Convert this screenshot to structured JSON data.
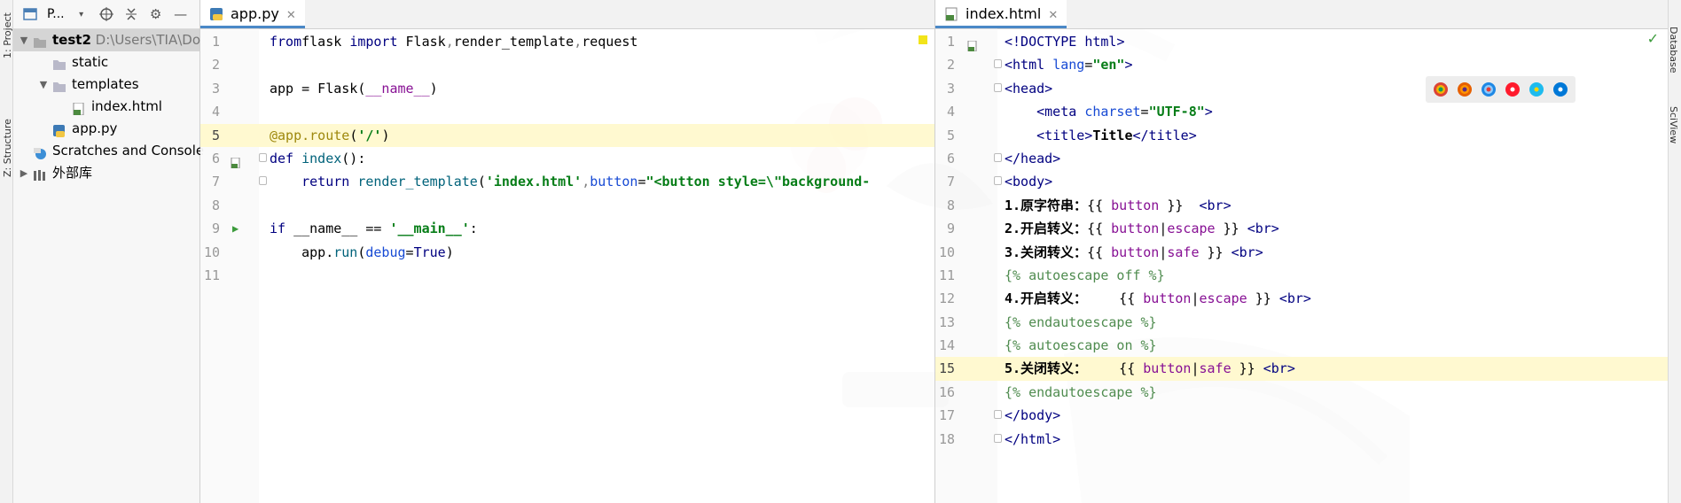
{
  "tool_windows": {
    "left": [
      "1: Project",
      "Z: Structure"
    ],
    "right": [
      "Database",
      "SciView"
    ]
  },
  "project_panel": {
    "toolbar_label": "P...",
    "tree": [
      {
        "label": "test2",
        "detail": "D:\\Users\\TIA\\Do",
        "type": "project",
        "expanded": true,
        "indent": 0
      },
      {
        "label": "static",
        "type": "folder",
        "indent": 1
      },
      {
        "label": "templates",
        "type": "folder",
        "expanded": true,
        "indent": 1
      },
      {
        "label": "index.html",
        "type": "html-file",
        "indent": 2
      },
      {
        "label": "app.py",
        "type": "py-file",
        "indent": 1
      },
      {
        "label": "Scratches and Console",
        "type": "scratches",
        "indent": 0
      },
      {
        "label": "外部库",
        "type": "library",
        "indent": 0
      }
    ]
  },
  "left_editor": {
    "tab": "app.py",
    "current_line": 5,
    "lines": [
      {
        "n": "1",
        "tokens": [
          [
            "kw",
            "from"
          ],
          [
            "",
            "flask "
          ],
          [
            "kw",
            "import"
          ],
          [
            "",
            " Flask"
          ],
          [
            "dim",
            ","
          ],
          [
            "",
            "render_template"
          ],
          [
            "dim",
            ","
          ],
          [
            "",
            "request"
          ]
        ]
      },
      {
        "n": "2",
        "tokens": []
      },
      {
        "n": "3",
        "tokens": [
          [
            "",
            "app = Flask("
          ],
          [
            "var",
            "__name__"
          ],
          [
            "",
            ")"
          ]
        ]
      },
      {
        "n": "4",
        "tokens": []
      },
      {
        "n": "5",
        "tokens": [
          [
            "deco",
            "@app."
          ],
          [
            "deco",
            "route"
          ],
          [
            "",
            "("
          ],
          [
            "str",
            "'/'"
          ],
          [
            "",
            ")"
          ]
        ]
      },
      {
        "n": "6",
        "tokens": [
          [
            "kw",
            "def "
          ],
          [
            "fn",
            "index"
          ],
          [
            "",
            "():"
          ]
        ]
      },
      {
        "n": "7",
        "tokens": [
          [
            "",
            "    "
          ],
          [
            "kw",
            "return "
          ],
          [
            "fn",
            "render_template"
          ],
          [
            "",
            "("
          ],
          [
            "str",
            "'index.html'"
          ],
          [
            "dim",
            ","
          ],
          [
            "attr",
            "button"
          ],
          [
            "",
            "="
          ],
          [
            "str",
            "\"<button style=\\\"background-"
          ]
        ]
      },
      {
        "n": "8",
        "tokens": []
      },
      {
        "n": "9",
        "tokens": [
          [
            "kw",
            "if "
          ],
          [
            "",
            "__name__ == "
          ],
          [
            "str",
            "'__main__'"
          ],
          [
            "",
            ":"
          ]
        ]
      },
      {
        "n": "10",
        "tokens": [
          [
            "",
            "    app."
          ],
          [
            "fn",
            "run"
          ],
          [
            "",
            "("
          ],
          [
            "attr",
            "debug"
          ],
          [
            "",
            "="
          ],
          [
            "kw",
            "True"
          ],
          [
            "",
            ")"
          ]
        ]
      },
      {
        "n": "11",
        "tokens": []
      }
    ]
  },
  "right_editor": {
    "tab": "index.html",
    "current_line": 15,
    "browsers": [
      "Chrome",
      "Firefox",
      "Safari",
      "Opera",
      "Internet Explorer",
      "Edge"
    ],
    "lines": [
      {
        "n": "1",
        "tokens": [
          [
            "tag",
            "<!DOCTYPE "
          ],
          [
            "tag",
            "html"
          ],
          [
            "tag",
            ">"
          ]
        ]
      },
      {
        "n": "2",
        "tokens": [
          [
            "tag",
            "<html "
          ],
          [
            "attr",
            "lang"
          ],
          [
            "",
            "="
          ],
          [
            "aval",
            "\"en\""
          ],
          [
            "tag",
            ">"
          ]
        ]
      },
      {
        "n": "3",
        "tokens": [
          [
            "tag",
            "<head>"
          ]
        ]
      },
      {
        "n": "4",
        "tokens": [
          [
            "",
            "    "
          ],
          [
            "tag",
            "<meta "
          ],
          [
            "attr",
            "charset"
          ],
          [
            "",
            "="
          ],
          [
            "aval",
            "\"UTF-8\""
          ],
          [
            "tag",
            ">"
          ]
        ]
      },
      {
        "n": "5",
        "tokens": [
          [
            "",
            "    "
          ],
          [
            "tag",
            "<title>"
          ],
          [
            "bold",
            "Title"
          ],
          [
            "tag",
            "</title>"
          ]
        ]
      },
      {
        "n": "6",
        "tokens": [
          [
            "tag",
            "</head>"
          ]
        ]
      },
      {
        "n": "7",
        "tokens": [
          [
            "tag",
            "<body>"
          ]
        ]
      },
      {
        "n": "8",
        "tokens": [
          [
            "bold",
            "1.原字符串："
          ],
          [
            "",
            "{{ "
          ],
          [
            "var",
            "button"
          ],
          [
            "",
            " }}  "
          ],
          [
            "tag",
            "<br>"
          ]
        ]
      },
      {
        "n": "9",
        "tokens": [
          [
            "bold",
            "2.开启转义："
          ],
          [
            "",
            "{{ "
          ],
          [
            "var",
            "button"
          ],
          [
            "",
            "|"
          ],
          [
            "var",
            "escape"
          ],
          [
            "",
            " }} "
          ],
          [
            "tag",
            "<br>"
          ]
        ]
      },
      {
        "n": "10",
        "tokens": [
          [
            "bold",
            "3.关闭转义："
          ],
          [
            "",
            "{{ "
          ],
          [
            "var",
            "button"
          ],
          [
            "",
            "|"
          ],
          [
            "var",
            "safe"
          ],
          [
            "",
            " }} "
          ],
          [
            "tag",
            "<br>"
          ]
        ]
      },
      {
        "n": "11",
        "tokens": [
          [
            "tpl",
            "{% autoescape off %}"
          ]
        ]
      },
      {
        "n": "12",
        "tokens": [
          [
            "bold",
            "4.开启转义："
          ],
          [
            "",
            "    {{ "
          ],
          [
            "var",
            "button"
          ],
          [
            "",
            "|"
          ],
          [
            "var",
            "escape"
          ],
          [
            "",
            " }} "
          ],
          [
            "tag",
            "<br>"
          ]
        ]
      },
      {
        "n": "13",
        "tokens": [
          [
            "tpl",
            "{% endautoescape %}"
          ]
        ]
      },
      {
        "n": "14",
        "tokens": [
          [
            "tpl",
            "{% autoescape on %}"
          ]
        ]
      },
      {
        "n": "15",
        "tokens": [
          [
            "bold",
            "5.关闭转义："
          ],
          [
            "",
            "    {{ "
          ],
          [
            "var",
            "button"
          ],
          [
            "",
            "|"
          ],
          [
            "var",
            "safe"
          ],
          [
            "",
            " }} "
          ],
          [
            "tag",
            "<br>"
          ]
        ]
      },
      {
        "n": "16",
        "tokens": [
          [
            "tpl",
            "{% endautoescape %}"
          ]
        ]
      },
      {
        "n": "17",
        "tokens": [
          [
            "tag",
            "</body>"
          ]
        ]
      },
      {
        "n": "18",
        "tokens": [
          [
            "tag",
            "</html>"
          ]
        ]
      }
    ]
  }
}
